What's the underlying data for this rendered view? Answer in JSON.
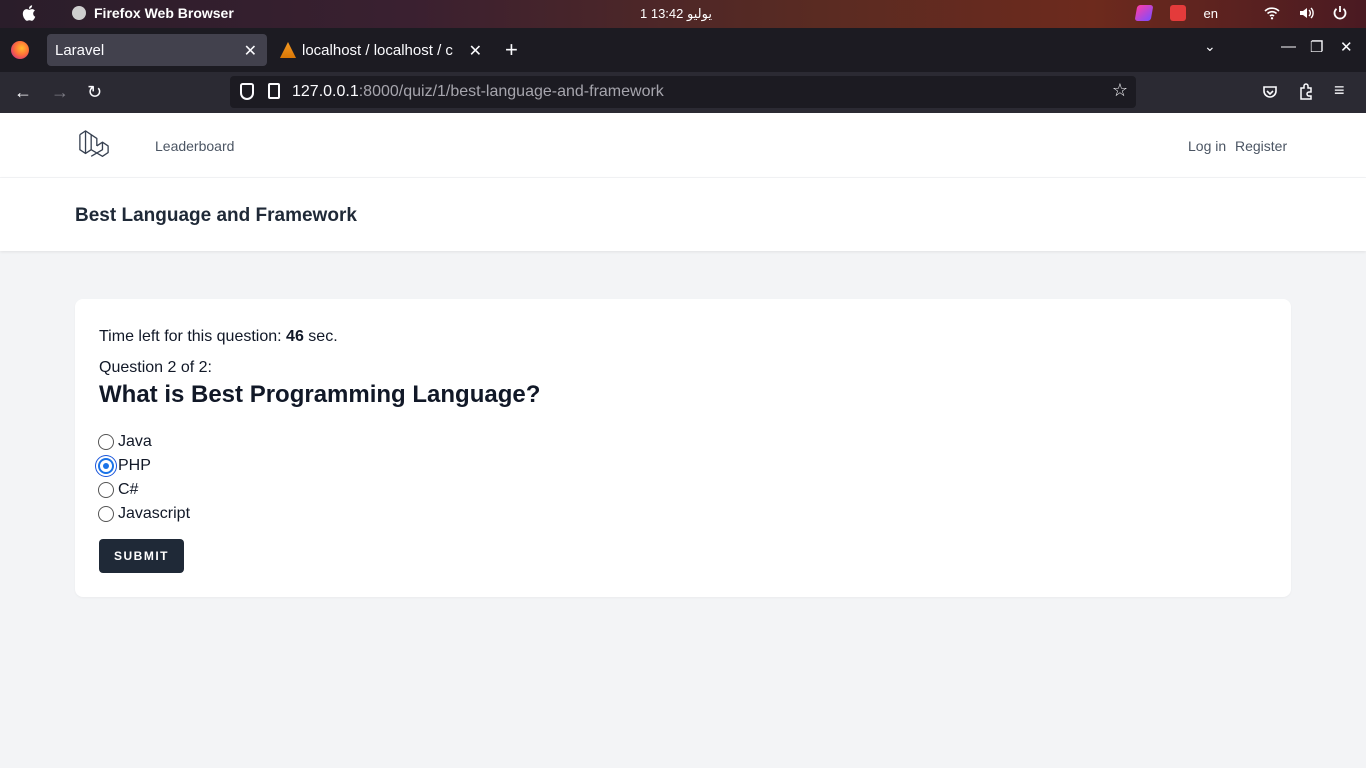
{
  "os": {
    "app_name": "Firefox Web Browser",
    "clock": "1 يوليو  13:42",
    "lang": "en"
  },
  "browser": {
    "tabs": [
      {
        "label": "Laravel",
        "active": true
      },
      {
        "label": "localhost / localhost / c",
        "active": false
      }
    ],
    "url_host": "127.0.0.1",
    "url_rest": ":8000/quiz/1/best-language-and-framework"
  },
  "app": {
    "nav": {
      "leaderboard": "Leaderboard",
      "login": "Log in",
      "register": "Register"
    },
    "page_title": "Best Language and Framework",
    "quiz": {
      "timer_prefix": "Time left for this question: ",
      "timer_value": "46",
      "timer_suffix": " sec.",
      "counter": "Question 2 of 2:",
      "question": "What is Best Programming Language?",
      "options": [
        {
          "label": "Java",
          "selected": false
        },
        {
          "label": "PHP",
          "selected": true
        },
        {
          "label": "C#",
          "selected": false
        },
        {
          "label": "Javascript",
          "selected": false
        }
      ],
      "submit_label": "SUBMIT"
    }
  },
  "colors": {
    "accent": "#1a73e8",
    "button": "#1f2937",
    "page_bg": "#f3f4f6"
  }
}
